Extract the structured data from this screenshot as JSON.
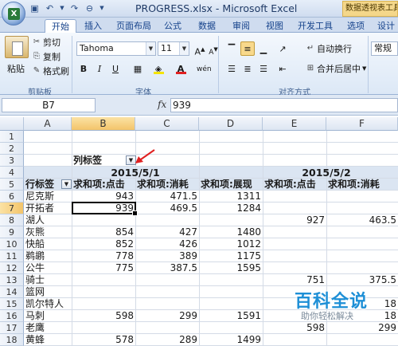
{
  "window": {
    "title": "PROGRESS.xlsx - Microsoft Excel",
    "context_tab": "数据透视表工具"
  },
  "ribbon_tabs": [
    "开始",
    "插入",
    "页面布局",
    "公式",
    "数据",
    "审阅",
    "视图",
    "开发工具",
    "选项",
    "设计"
  ],
  "ribbon": {
    "clipboard": {
      "paste": "粘贴",
      "cut": "剪切",
      "copy": "复制",
      "format_painter": "格式刷",
      "label": "剪贴板"
    },
    "font": {
      "name": "Tahoma",
      "size": "11",
      "bold": "B",
      "italic": "I",
      "underline": "U",
      "label": "字体",
      "highlight_color": "#f5e400",
      "font_color": "#e02020"
    },
    "alignment": {
      "wrap_text": "自动换行",
      "merge_center": "合并后居中",
      "label": "对齐方式"
    },
    "number": {
      "format": "常规"
    }
  },
  "formula_bar": {
    "name_box": "B7",
    "fx": "fx",
    "formula": "939"
  },
  "grid": {
    "columns": [
      "A",
      "B",
      "C",
      "D",
      "E",
      "F"
    ],
    "selected_column": "B",
    "selected_row": "7",
    "rows": [
      "1",
      "2",
      "3",
      "4",
      "5",
      "6",
      "7",
      "8",
      "9",
      "10",
      "11",
      "12",
      "13",
      "14",
      "15",
      "16",
      "17",
      "18"
    ],
    "col_label_header": "列标签",
    "row_label_header": "行标签",
    "date1": "2015/5/1",
    "date2": "2015/5/2",
    "measures": [
      "求和项:点击",
      "求和项:消耗",
      "求和项:展现",
      "求和项:点击",
      "求和项:消耗",
      "求和项"
    ],
    "data_rows": [
      {
        "label": "尼克斯",
        "b": "943",
        "c": "471.5",
        "d": "1311",
        "e": "",
        "f": ""
      },
      {
        "label": "开拓者",
        "b": "939",
        "c": "469.5",
        "d": "1284",
        "e": "",
        "f": ""
      },
      {
        "label": "湖人",
        "b": "",
        "c": "",
        "d": "",
        "e": "927",
        "f": "463.5"
      },
      {
        "label": "灰熊",
        "b": "854",
        "c": "427",
        "d": "1480",
        "e": "",
        "f": ""
      },
      {
        "label": "快船",
        "b": "852",
        "c": "426",
        "d": "1012",
        "e": "",
        "f": ""
      },
      {
        "label": "鹈鹕",
        "b": "778",
        "c": "389",
        "d": "1175",
        "e": "",
        "f": ""
      },
      {
        "label": "公牛",
        "b": "775",
        "c": "387.5",
        "d": "1595",
        "e": "",
        "f": ""
      },
      {
        "label": "骑士",
        "b": "",
        "c": "",
        "d": "",
        "e": "751",
        "f": "375.5"
      },
      {
        "label": "篮网",
        "b": "",
        "c": "",
        "d": "",
        "e": "",
        "f": ""
      },
      {
        "label": "凯尔特人",
        "b": "",
        "c": "",
        "d": "",
        "e": "",
        "f": "18"
      },
      {
        "label": "马刺",
        "b": "598",
        "c": "299",
        "d": "1591",
        "e": "",
        "f": "18"
      },
      {
        "label": "老鹰",
        "b": "",
        "c": "",
        "d": "",
        "e": "598",
        "f": "299"
      },
      {
        "label": "黄蜂",
        "b": "578",
        "c": "289",
        "d": "1499",
        "e": "",
        "f": ""
      }
    ]
  },
  "watermark": {
    "title": "百科全说",
    "subtitle": "助你轻松解决"
  }
}
